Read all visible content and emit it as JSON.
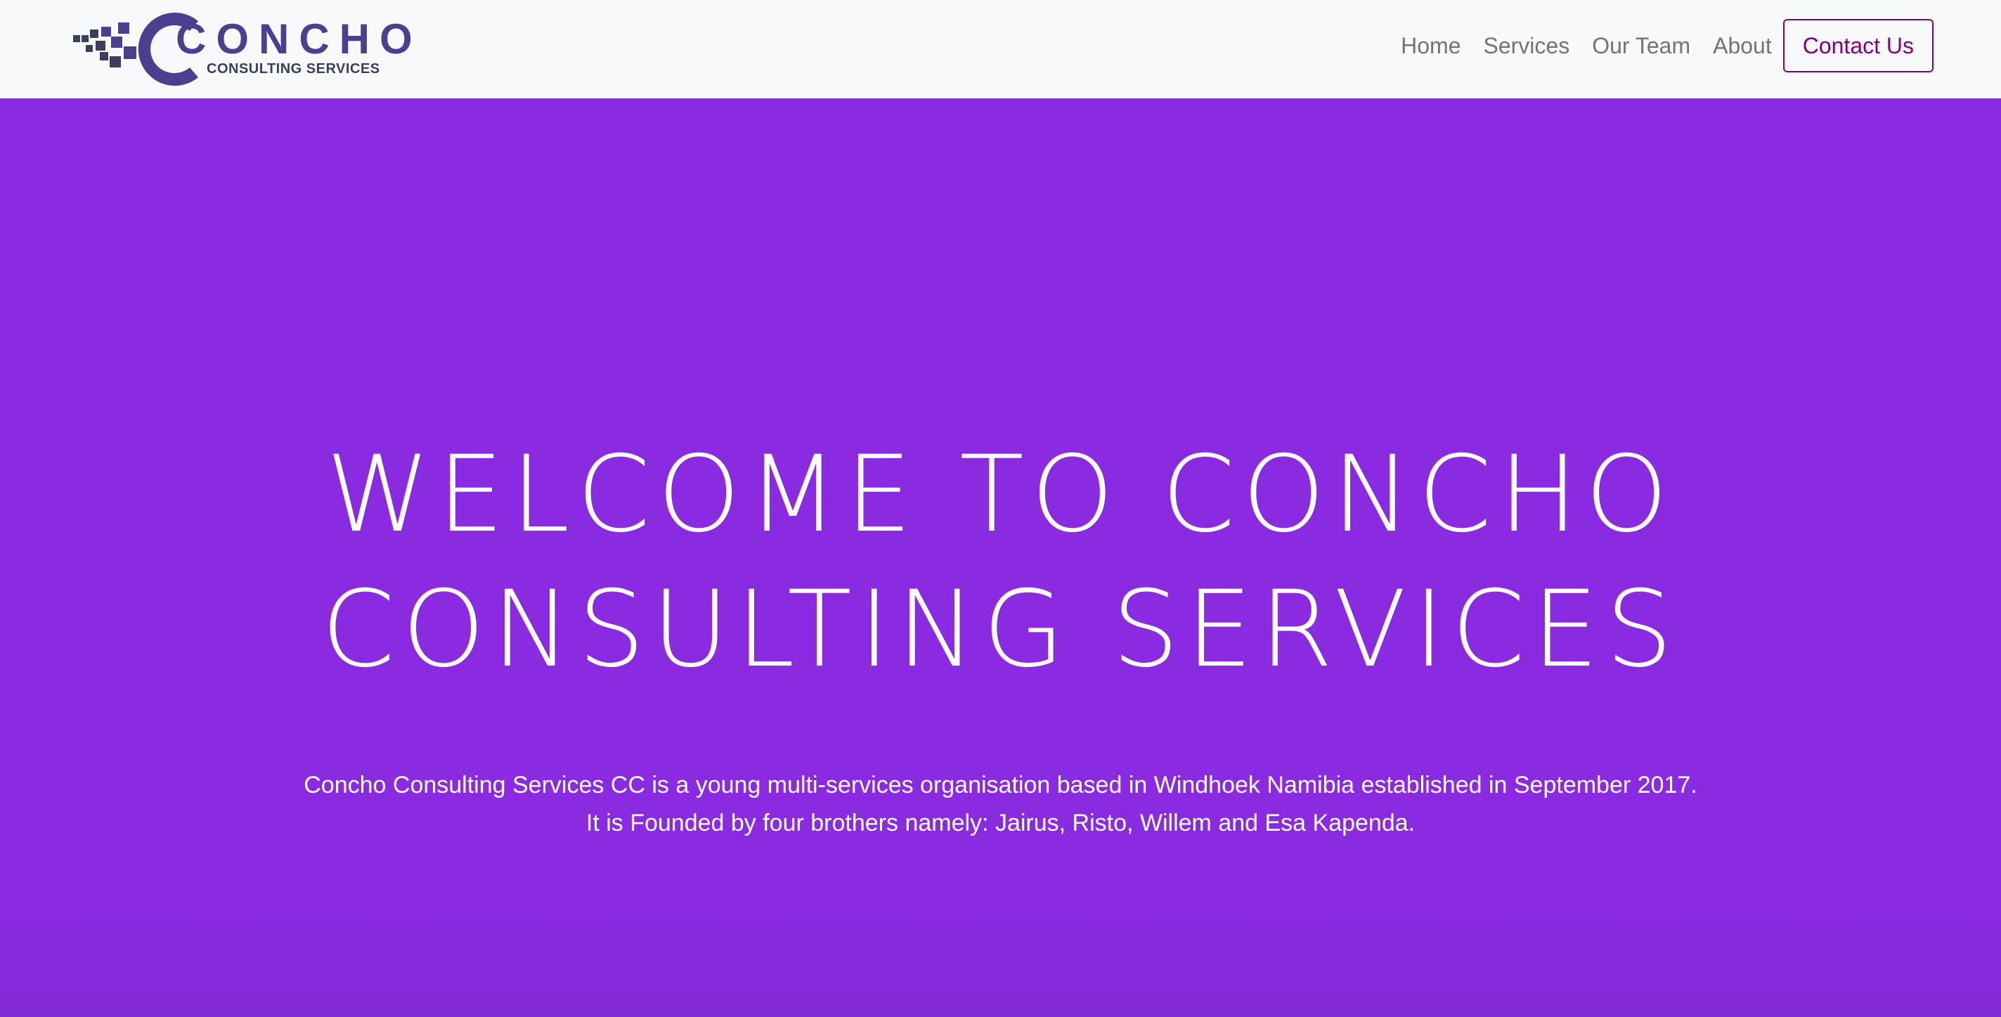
{
  "brand": {
    "name": "CONCHO",
    "tagline": "CONSULTING SERVICES",
    "color": "#4b3f8f"
  },
  "nav": {
    "items": [
      {
        "label": "Home"
      },
      {
        "label": "Services"
      },
      {
        "label": "Our Team"
      },
      {
        "label": "About"
      }
    ],
    "cta_label": "Contact Us",
    "cta_color": "#800080"
  },
  "hero": {
    "background": "#8a2be2",
    "title_line1": "WELCOME TO CONCHO",
    "title_line2": "CONSULTING SERVICES",
    "description_line1": "Concho Consulting Services CC is a young multi-services organisation based in Windhoek Namibia established in September 2017.",
    "description_line2": "It is Founded by four brothers namely: Jairus, Risto, Willem and Esa Kapenda."
  }
}
